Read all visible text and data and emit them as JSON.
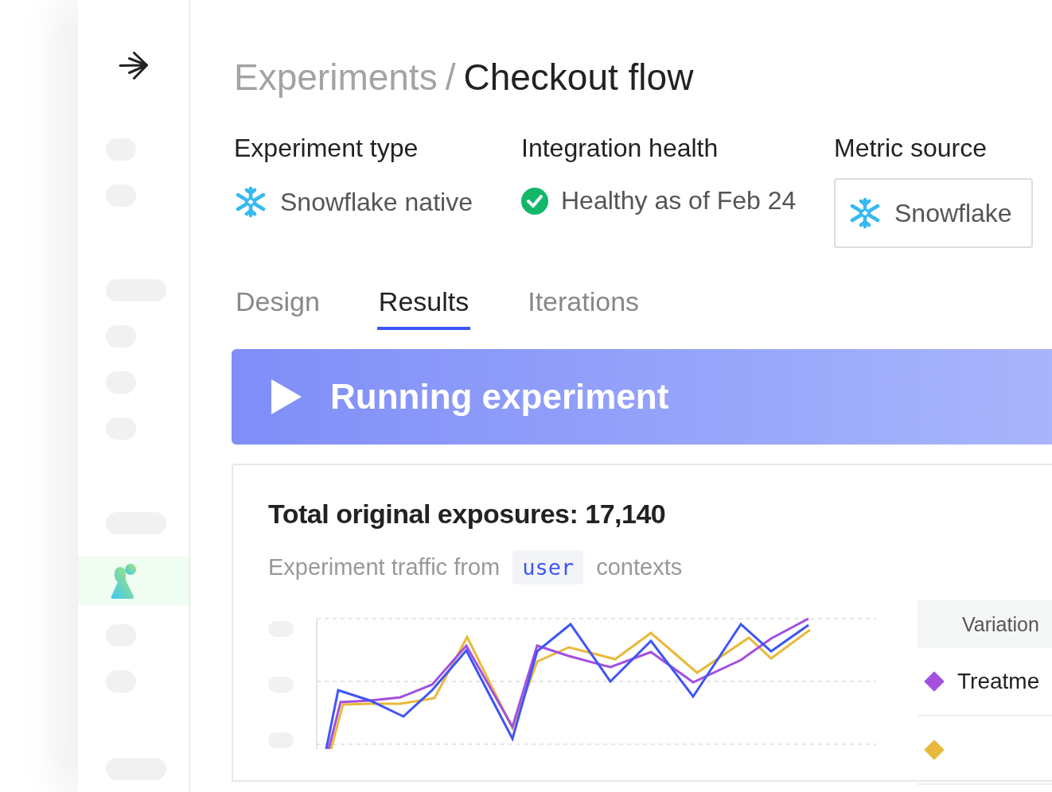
{
  "sidebar": {
    "items": [
      {
        "kind": "short",
        "selected": false
      },
      {
        "kind": "short",
        "selected": false
      },
      {
        "kind": "wide",
        "selected": false
      },
      {
        "kind": "short",
        "selected": false
      },
      {
        "kind": "short",
        "selected": false
      },
      {
        "kind": "short",
        "selected": false
      },
      {
        "kind": "wide",
        "selected": false
      },
      {
        "kind": "icon",
        "selected": true
      },
      {
        "kind": "short",
        "selected": false
      },
      {
        "kind": "short",
        "selected": false
      },
      {
        "kind": "wide",
        "selected": false
      }
    ]
  },
  "breadcrumb": {
    "parent": "Experiments",
    "separator": "/",
    "current": "Checkout flow"
  },
  "properties": [
    {
      "label": "Experiment type",
      "kind": "snowflake",
      "value": "Snowflake native"
    },
    {
      "label": "Integration health",
      "kind": "health",
      "value": "Healthy as of Feb 24"
    },
    {
      "label": "Metric source",
      "kind": "select",
      "value": "Snowflake"
    }
  ],
  "tabs": [
    {
      "label": "Design",
      "selected": false
    },
    {
      "label": "Results",
      "selected": true
    },
    {
      "label": "Iterations",
      "selected": false
    }
  ],
  "banner": {
    "text": "Running experiment"
  },
  "exposures": {
    "title": "Total original exposures: 17,140",
    "subtitle_before": "Experiment traffic from",
    "context": "user",
    "subtitle_after": "contexts"
  },
  "legend": {
    "header": "Variation",
    "rows": [
      {
        "label": "Treatme",
        "color": "#a24fe0"
      },
      {
        "label": "",
        "color": "#e8b93a"
      }
    ]
  }
}
